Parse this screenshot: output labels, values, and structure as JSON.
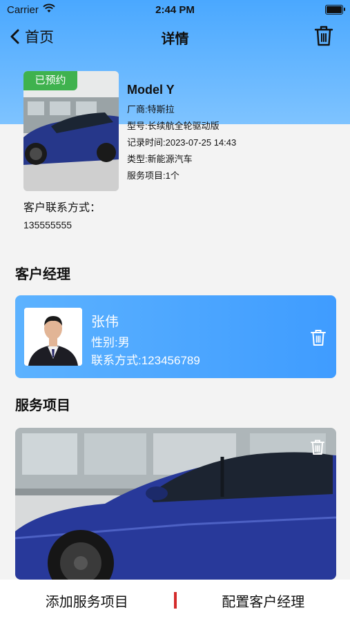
{
  "status": {
    "carrier": "Carrier",
    "time": "2:44 PM"
  },
  "nav": {
    "back_label": "首页",
    "title": "详情"
  },
  "car": {
    "badge": "已预约",
    "model": "Model Y",
    "maker": "厂商:特斯拉",
    "variant": "型号:长续航全轮驱动版",
    "record_time": "记录时间:2023-07-25 14:43",
    "category": "类型:新能源汽车",
    "service_count": "服务项目:1个"
  },
  "customer": {
    "contact_label": "客户联系方式：",
    "contact_value": "135555555"
  },
  "manager_section": {
    "title": "客户经理"
  },
  "manager": {
    "name": "张伟",
    "gender": "性别:男",
    "contact": "联系方式:123456789"
  },
  "service_section": {
    "title": "服务项目"
  },
  "bottom": {
    "add_service": "添加服务项目",
    "assign_manager": "配置客户经理"
  },
  "colors": {
    "header_blue": "#4aa8ff",
    "badge_green": "#3fb24e",
    "divider_red": "#d42b2b"
  }
}
